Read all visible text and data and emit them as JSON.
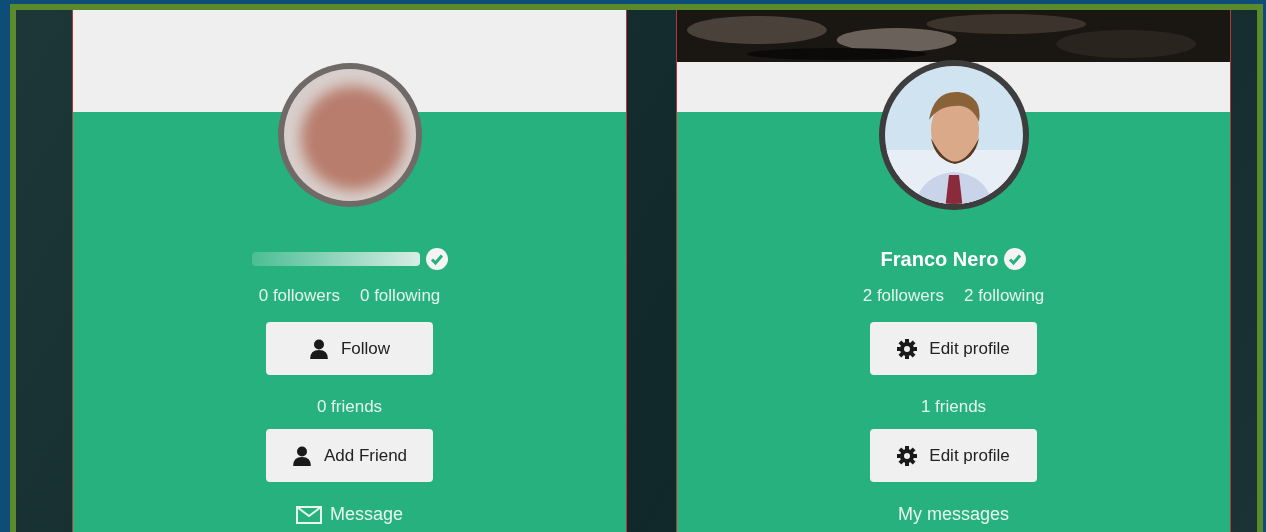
{
  "profiles": [
    {
      "cover": false,
      "avatar": {
        "kind": "picture",
        "blurred": true
      },
      "name_hidden": true,
      "verified": true,
      "followers": "0 followers",
      "following": "0 following",
      "friends": "0 friends",
      "buttons": [
        {
          "kind": "person",
          "label": "Follow"
        },
        {
          "kind": "person",
          "label": "Add Friend"
        }
      ],
      "footer_link": {
        "kind": "envelope",
        "label": "Message"
      }
    },
    {
      "cover": true,
      "avatar": {
        "kind": "picture",
        "blurred": false
      },
      "name_hidden": false,
      "name": "Franco Nero",
      "verified": true,
      "followers": "2 followers",
      "following": "2 following",
      "friends": "1 friends",
      "buttons": [
        {
          "kind": "gear",
          "label": "Edit profile"
        },
        {
          "kind": "gear",
          "label": "Edit profile"
        }
      ],
      "footer_link": {
        "kind": "plain",
        "label": "My messages"
      }
    }
  ]
}
